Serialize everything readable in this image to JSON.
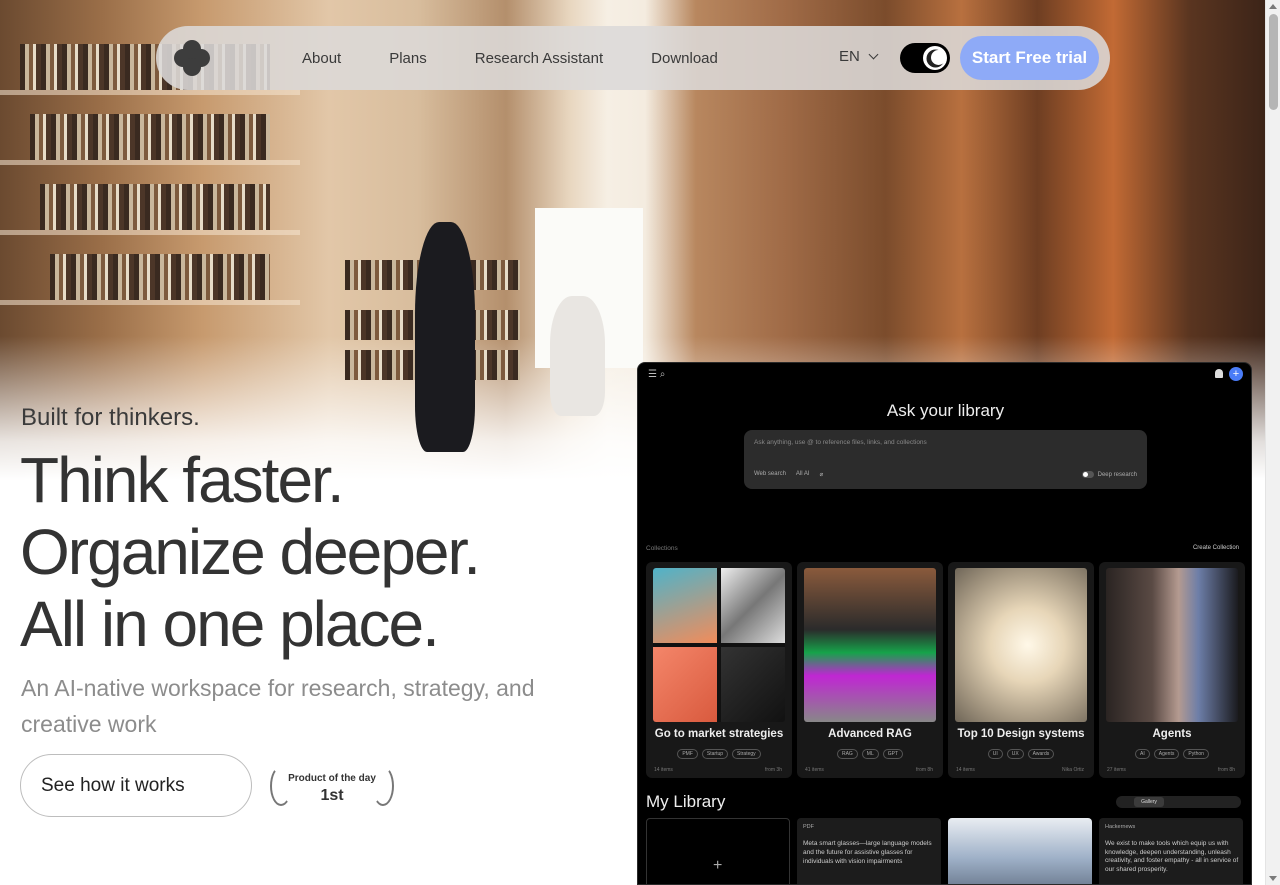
{
  "nav": {
    "links": [
      "About",
      "Plans",
      "Research Assistant",
      "Download"
    ],
    "lang": "EN",
    "cta": "Start Free trial"
  },
  "hero": {
    "tagline": "Built for thinkers.",
    "line1": "Think faster.",
    "line2": "Organize deeper.",
    "line3": "All in one place.",
    "subtitle": "An AI-native workspace for research, strategy, and creative work",
    "button": "See how it works",
    "award_line1": "Product of the day",
    "award_line2": "1st"
  },
  "app": {
    "ask_title": "Ask your library",
    "ask_placeholder": "Ask anything, use @ to reference files, links, and collections",
    "opt_web": "Web search",
    "opt_model": "All AI",
    "deep_research": "Deep research",
    "collections_label": "Collections",
    "create_collection": "Create Collection",
    "cards": [
      {
        "name": "Go to market strategies",
        "tags": [
          "PMF",
          "Startup",
          "Strategy"
        ],
        "count": "14 items",
        "when": "from 3h"
      },
      {
        "name": "Advanced RAG",
        "tags": [
          "RAG",
          "ML",
          "GPT"
        ],
        "count": "41 items",
        "when": "from 8h"
      },
      {
        "name": "Top 10 Design systems",
        "tags": [
          "UI",
          "UX",
          "Awards"
        ],
        "count": "14 items",
        "when": "Nika Ortiz"
      },
      {
        "name": "Agents",
        "tags": [
          "AI",
          "Agents",
          "Python"
        ],
        "count": "27 items",
        "when": "from 8h"
      }
    ],
    "library_title": "My Library",
    "gallery_label": "Gallery",
    "lib_pdf_label": "PDF",
    "lib_pdf_text": "Meta smart glasses—large language models and the future for assistive glasses for individuals with vision impairments",
    "lib_hn_label": "Hackernews",
    "lib_hn_text": "We exist to make tools which equip us with knowledge, deepen understanding, unleash creativity, and foster empathy - all in service of our shared prosperity."
  }
}
